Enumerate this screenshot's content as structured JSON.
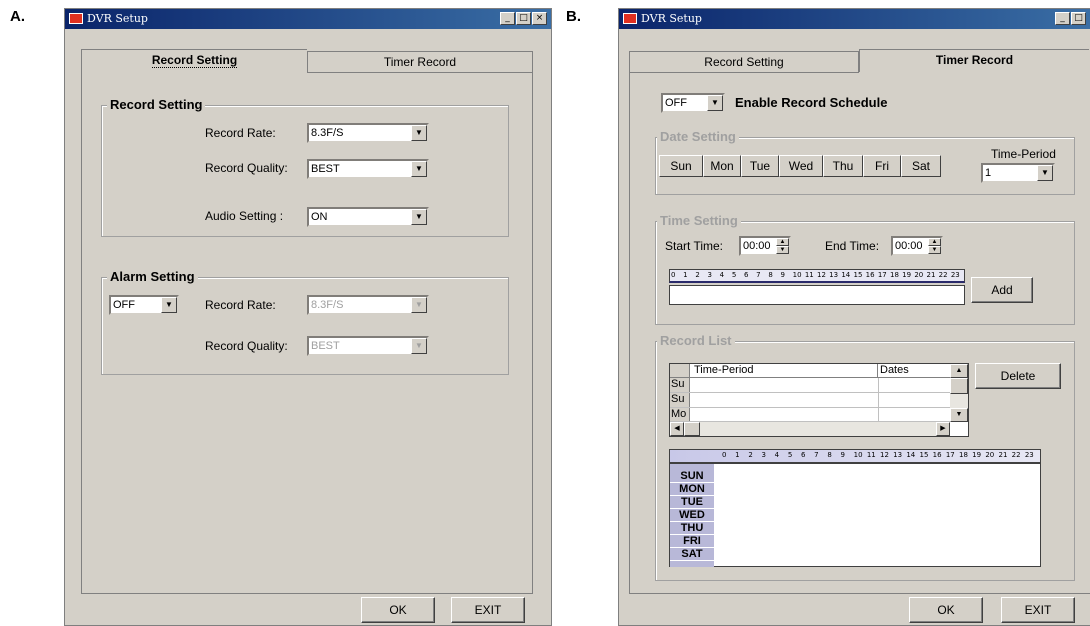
{
  "labels": {
    "a": "A.",
    "b": "B."
  },
  "window": {
    "title": "DVR Setup",
    "min_icon": "minimize-icon",
    "max_icon": "maximize-icon",
    "close_icon": "close-icon"
  },
  "tabs": {
    "record_setting": "Record Setting",
    "timer_record": "Timer Record"
  },
  "panelA": {
    "record_group": {
      "title": "Record Setting",
      "record_rate_label": "Record Rate:",
      "record_rate_value": "8.3F/S",
      "record_quality_label": "Record Quality:",
      "record_quality_value": "BEST",
      "audio_label": "Audio Setting :",
      "audio_value": "ON"
    },
    "alarm_group": {
      "title": "Alarm Setting",
      "toggle_value": "OFF",
      "record_rate_label": "Record Rate:",
      "record_rate_value": "8.3F/S",
      "record_quality_label": "Record Quality:",
      "record_quality_value": "BEST"
    },
    "ok": "OK",
    "exit": "EXIT"
  },
  "panelB": {
    "schedule_toggle": "OFF",
    "enable_label": "Enable Record Schedule",
    "date_group": {
      "title": "Date Setting",
      "days": [
        "Sun",
        "Mon",
        "Tue",
        "Wed",
        "Thu",
        "Fri",
        "Sat"
      ],
      "time_period_label": "Time-Period",
      "time_period_value": "1"
    },
    "time_group": {
      "title": "Time Setting",
      "start_label": "Start Time:",
      "start_value": "00:00",
      "end_label": "End Time:",
      "end_value": "00:00",
      "hours": [
        "0",
        "1",
        "2",
        "3",
        "4",
        "5",
        "6",
        "7",
        "8",
        "9",
        "10",
        "11",
        "12",
        "13",
        "14",
        "15",
        "16",
        "17",
        "18",
        "19",
        "20",
        "21",
        "22",
        "23"
      ],
      "add": "Add"
    },
    "list_group": {
      "title": "Record List",
      "col_period": "Time-Period",
      "col_dates": "Dates",
      "rows": [
        "Su",
        "Su",
        "Mo"
      ],
      "delete": "Delete",
      "week_days": [
        "SUN",
        "MON",
        "TUE",
        "WED",
        "THU",
        "FRI",
        "SAT"
      ]
    },
    "ok": "OK",
    "exit": "EXIT"
  }
}
